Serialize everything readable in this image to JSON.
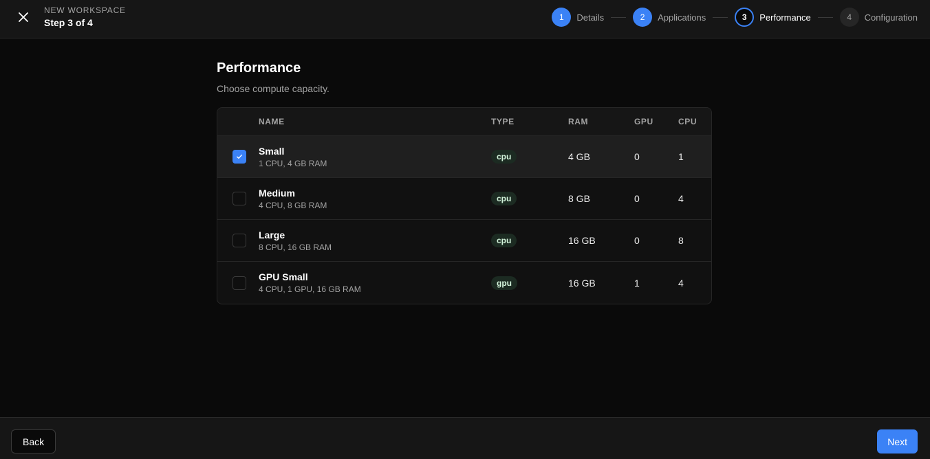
{
  "header": {
    "eyebrow": "NEW WORKSPACE",
    "step_count": "Step 3 of 4",
    "close_icon": "close-icon",
    "steps": [
      {
        "number": "1",
        "label": "Details",
        "state": "done"
      },
      {
        "number": "2",
        "label": "Applications",
        "state": "done"
      },
      {
        "number": "3",
        "label": "Performance",
        "state": "current"
      },
      {
        "number": "4",
        "label": "Configuration",
        "state": "todo"
      }
    ]
  },
  "main": {
    "title": "Performance",
    "subtitle": "Choose compute capacity.",
    "table": {
      "columns": {
        "name": "NAME",
        "type": "TYPE",
        "ram": "RAM",
        "gpu": "GPU",
        "cpu": "CPU"
      },
      "rows": [
        {
          "name": "Small",
          "desc": "1 CPU, 4 GB RAM",
          "type": "cpu",
          "ram": "4 GB",
          "gpu": "0",
          "cpu": "1",
          "selected": true
        },
        {
          "name": "Medium",
          "desc": "4 CPU, 8 GB RAM",
          "type": "cpu",
          "ram": "8 GB",
          "gpu": "0",
          "cpu": "4",
          "selected": false
        },
        {
          "name": "Large",
          "desc": "8 CPU, 16 GB RAM",
          "type": "cpu",
          "ram": "16 GB",
          "gpu": "0",
          "cpu": "8",
          "selected": false
        },
        {
          "name": "GPU Small",
          "desc": "4 CPU, 1 GPU, 16 GB RAM",
          "type": "gpu",
          "ram": "16 GB",
          "gpu": "1",
          "cpu": "4",
          "selected": false
        }
      ]
    }
  },
  "footer": {
    "back_label": "Back",
    "next_label": "Next"
  },
  "colors": {
    "accent": "#3b82f6",
    "background": "#0a0a0a",
    "badge_bg": "#1c2b22"
  }
}
